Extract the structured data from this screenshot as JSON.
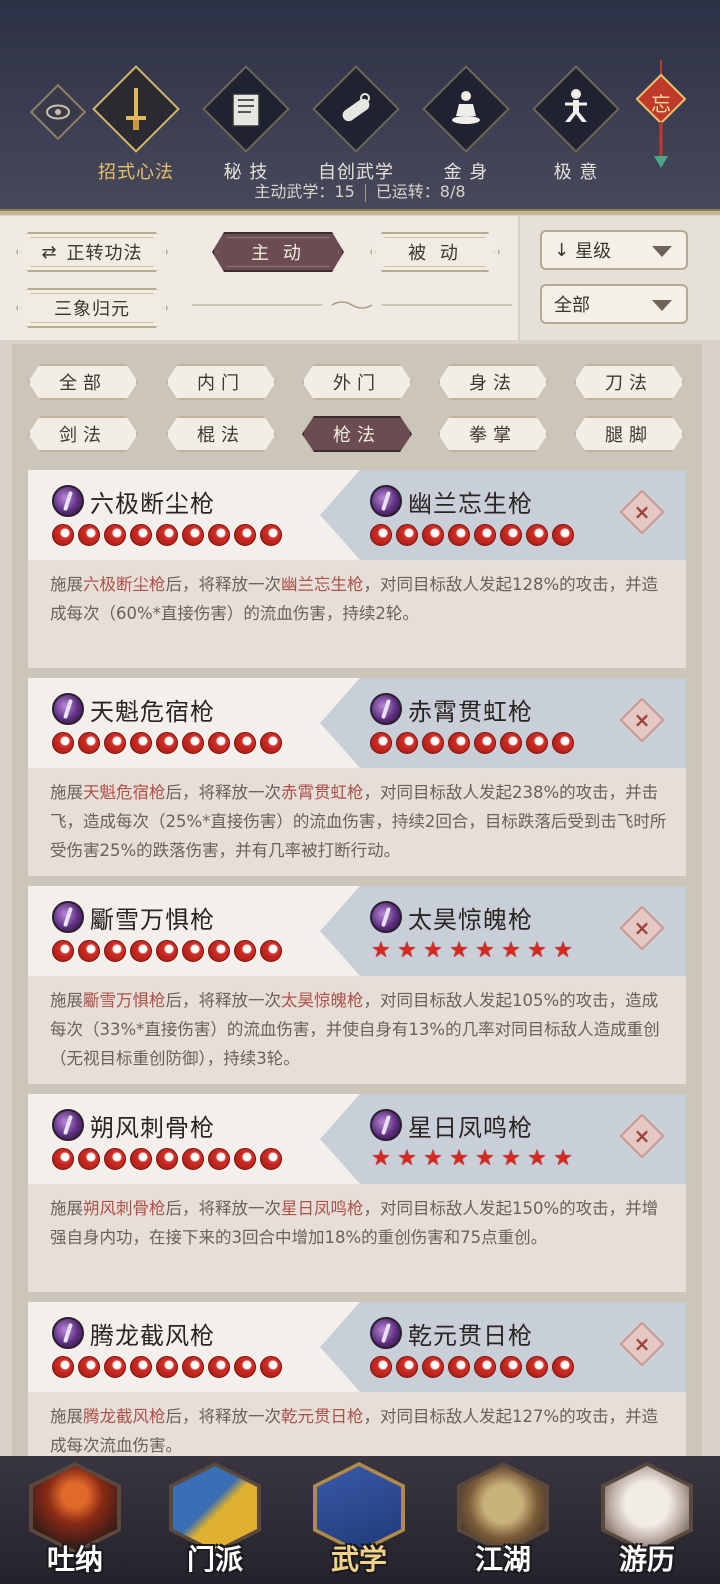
{
  "top_tabs": [
    {
      "label": "招式心法",
      "icon": "sword-icon",
      "active": true
    },
    {
      "label": "秘 技",
      "icon": "book-icon",
      "active": false
    },
    {
      "label": "自创武学",
      "icon": "scroll-icon",
      "active": false
    },
    {
      "label": "金 身",
      "icon": "meditation-icon",
      "active": false
    },
    {
      "label": "极 意",
      "icon": "martial-pose-icon",
      "active": false
    }
  ],
  "seal": {
    "text": "忘"
  },
  "counts": {
    "active_label": "主动武学：15",
    "used_label": "已运转：8/8"
  },
  "filters": {
    "reverse_label": "正转功法",
    "active_tab": "主 动",
    "passive_tab": "被 动",
    "sanxiang_label": "三象归元",
    "sort_label": "星级",
    "type_label": "全部"
  },
  "categories": [
    {
      "label": "全部",
      "active": false
    },
    {
      "label": "内门",
      "active": false
    },
    {
      "label": "外门",
      "active": false
    },
    {
      "label": "身法",
      "active": false
    },
    {
      "label": "刀法",
      "active": false
    },
    {
      "label": "剑法",
      "active": false
    },
    {
      "label": "棍法",
      "active": false
    },
    {
      "label": "枪法",
      "active": true
    },
    {
      "label": "拳掌",
      "active": false
    },
    {
      "label": "腿脚",
      "active": false
    }
  ],
  "combos": [
    {
      "left": {
        "name": "六极断尘枪",
        "rating_type": "dot",
        "rating": 9
      },
      "right": {
        "name": "幽兰忘生枪",
        "rating_type": "dot",
        "rating": 8
      },
      "desc": {
        "p1": "施展",
        "s1": "六极断尘枪",
        "p2": "后，将释放一次",
        "s2": "幽兰忘生枪",
        "p3": "，对同目标敌人发起128%的攻击，并造成每次（60%*直接伤害）的流血伤害，持续2轮。"
      }
    },
    {
      "left": {
        "name": "天魁危宿枪",
        "rating_type": "dot",
        "rating": 9
      },
      "right": {
        "name": "赤霄贯虹枪",
        "rating_type": "dot",
        "rating": 8
      },
      "desc": {
        "p1": "施展",
        "s1": "天魁危宿枪",
        "p2": "后，将释放一次",
        "s2": "赤霄贯虹枪",
        "p3": "，对同目标敌人发起238%的攻击，并击飞，造成每次（25%*直接伤害）的流血伤害，持续2回合，目标跌落后受到击飞时所受伤害25%的跌落伤害，并有几率被打断行动。"
      }
    },
    {
      "left": {
        "name": "斸雪万惧枪",
        "rating_type": "dot",
        "rating": 9
      },
      "right": {
        "name": "太昊惊魄枪",
        "rating_type": "star",
        "rating": 8
      },
      "desc": {
        "p1": "施展",
        "s1": "斸雪万惧枪",
        "p2": "后，将释放一次",
        "s2": "太昊惊魄枪",
        "p3": "，对同目标敌人发起105%的攻击，造成每次（33%*直接伤害）的流血伤害，并使自身有13%的几率对同目标敌人造成重创（无视目标重创防御），持续3轮。"
      }
    },
    {
      "left": {
        "name": "朔风刺骨枪",
        "rating_type": "dot",
        "rating": 9
      },
      "right": {
        "name": "星日凤鸣枪",
        "rating_type": "star",
        "rating": 8
      },
      "desc": {
        "p1": "施展",
        "s1": "朔风刺骨枪",
        "p2": "后，将释放一次",
        "s2": "星日凤鸣枪",
        "p3": "，对同目标敌人发起150%的攻击，并增强自身内功，在接下来的3回合中增加18%的重创伤害和75点重创。"
      }
    },
    {
      "left": {
        "name": "腾龙截风枪",
        "rating_type": "dot",
        "rating": 9
      },
      "right": {
        "name": "乾元贯日枪",
        "rating_type": "dot",
        "rating": 8
      },
      "desc": {
        "p1": "施展",
        "s1": "腾龙截风枪",
        "p2": "后，将释放一次",
        "s2": "乾元贯日枪",
        "p3": "，对同目标敌人发起127%的攻击，并造成每次流血伤害。"
      }
    }
  ],
  "bottom_nav": [
    {
      "label": "吐纳",
      "icon": "monk-icon",
      "active": false
    },
    {
      "label": "门派",
      "icon": "sect-banner-icon",
      "active": false
    },
    {
      "label": "武学",
      "icon": "martial-book-icon",
      "active": true
    },
    {
      "label": "江湖",
      "icon": "bamboo-hat-icon",
      "active": false
    },
    {
      "label": "游历",
      "icon": "horse-icon",
      "active": false
    }
  ],
  "colors": {
    "accent_gold": "#e8c26a",
    "active_tab": "#6b4c50",
    "skill_highlight": "#b0504a",
    "rating_red": "#d22f26"
  }
}
